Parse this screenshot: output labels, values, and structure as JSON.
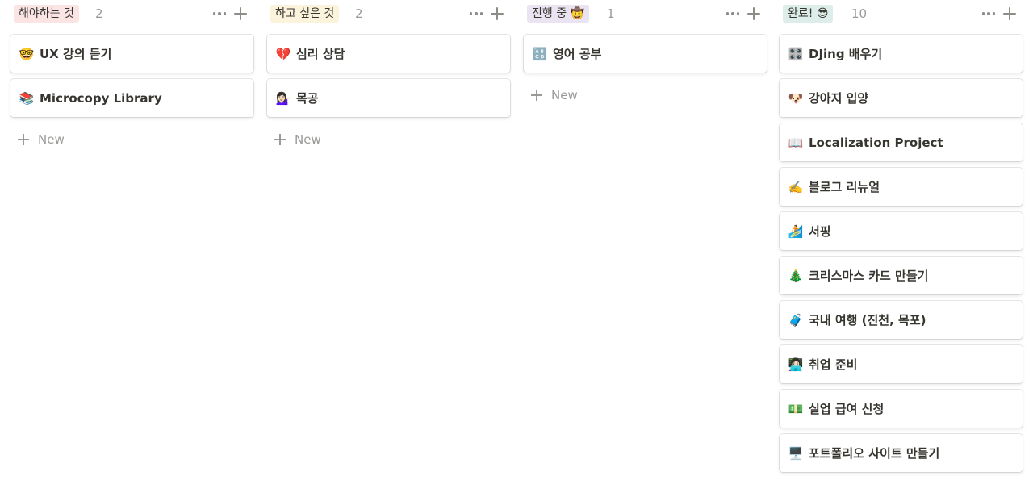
{
  "columns": [
    {
      "title": "해야하는 것",
      "count": "2",
      "tag_color": "#fbe4e4",
      "cards": [
        {
          "icon": "🤓",
          "icon_name": "nerd-face-icon",
          "title": "UX 강의 듣기"
        },
        {
          "icon": "📚",
          "icon_name": "books-icon",
          "title": "Microcopy Library"
        }
      ],
      "new_label": "New"
    },
    {
      "title": "하고 싶은 것",
      "count": "2",
      "tag_color": "#fbf3db",
      "cards": [
        {
          "icon": "💔",
          "icon_name": "broken-heart-icon",
          "title": "심리 상담"
        },
        {
          "icon": "💁🏻‍♀️",
          "icon_name": "person-tipping-hand-icon",
          "title": "목공"
        }
      ],
      "new_label": "New"
    },
    {
      "title": "진행 중 🤠",
      "count": "1",
      "tag_color": "#eae4f2",
      "cards": [
        {
          "icon": "🔠",
          "icon_name": "abcd-input-icon",
          "title": "영어 공부"
        }
      ],
      "new_label": "New"
    },
    {
      "title": "완료! 😎",
      "count": "10",
      "tag_color": "#ddedea",
      "cards": [
        {
          "icon": "🎛️",
          "icon_name": "control-knobs-icon",
          "title": "DJing 배우기"
        },
        {
          "icon": "🐶",
          "icon_name": "dog-face-icon",
          "title": "강아지 입양"
        },
        {
          "icon": "📖",
          "icon_name": "open-book-icon",
          "title": "Localization Project"
        },
        {
          "icon": "✍️",
          "icon_name": "writing-hand-icon",
          "title": "블로그 리뉴얼"
        },
        {
          "icon": "🏄",
          "icon_name": "surfer-icon",
          "title": "서핑"
        },
        {
          "icon": "🎄",
          "icon_name": "christmas-tree-icon",
          "title": "크리스마스 카드 만들기"
        },
        {
          "icon": "🧳",
          "icon_name": "luggage-icon",
          "title": "국내 여행 (진천, 목포)"
        },
        {
          "icon": "👩🏻‍💻",
          "icon_name": "woman-technologist-icon",
          "title": "취업 준비"
        },
        {
          "icon": "💵",
          "icon_name": "dollar-banknote-icon",
          "title": "실업 급여 신청"
        },
        {
          "icon": "🖥️",
          "icon_name": "desktop-computer-icon",
          "title": "포트폴리오 사이트 만들기"
        }
      ],
      "new_label": ""
    }
  ]
}
